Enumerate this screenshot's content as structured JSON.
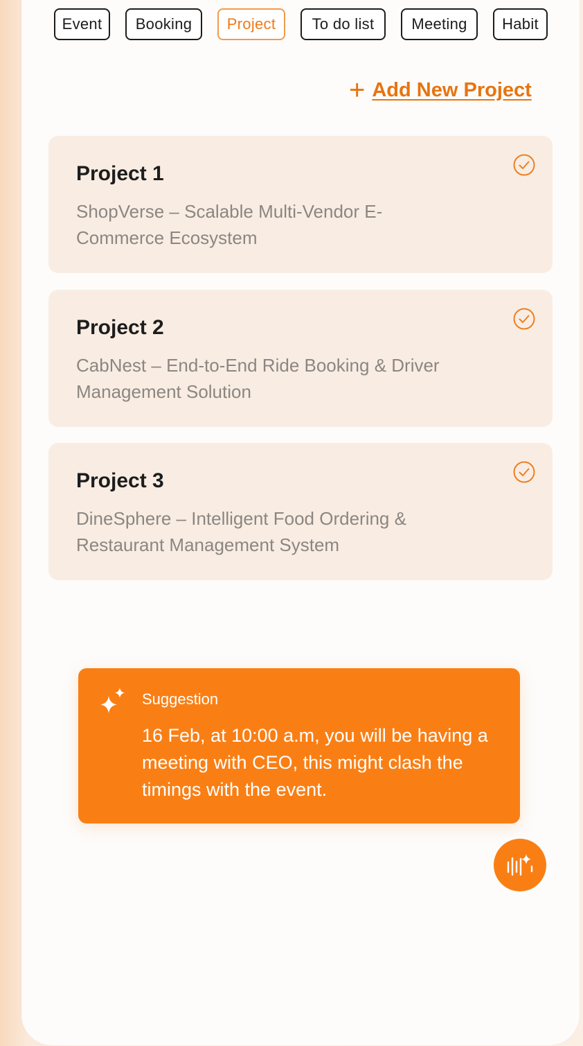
{
  "tabs": [
    {
      "label": "Event"
    },
    {
      "label": "Booking"
    },
    {
      "label": "Project",
      "active": true
    },
    {
      "label": "To do list"
    },
    {
      "label": "Meeting"
    },
    {
      "label": "Habit"
    }
  ],
  "add_project": {
    "label": "Add New Project",
    "icon": "plus-icon"
  },
  "projects": [
    {
      "title": "Project 1",
      "description": "ShopVerse – Scalable Multi-Vendor E-Commerce Ecosystem",
      "icon": "check-circle-icon"
    },
    {
      "title": "Project 2",
      "description": "CabNest – End-to-End Ride Booking & Driver Management Solution",
      "icon": "check-circle-icon"
    },
    {
      "title": "Project 3",
      "description": "DineSphere – Intelligent Food Ordering & Restaurant Management System",
      "icon": "check-circle-icon"
    }
  ],
  "suggestion": {
    "title": "Suggestion",
    "body": "16 Feb, at 10:00 a.m, you will be having a meeting with CEO, this might clash the timings with the event.",
    "icon": "sparkle-icon"
  },
  "fab": {
    "icon": "voice-ai-icon"
  },
  "colors": {
    "accent": "#f97f15",
    "card_bg": "#f9ede3",
    "link": "#e8740e"
  }
}
